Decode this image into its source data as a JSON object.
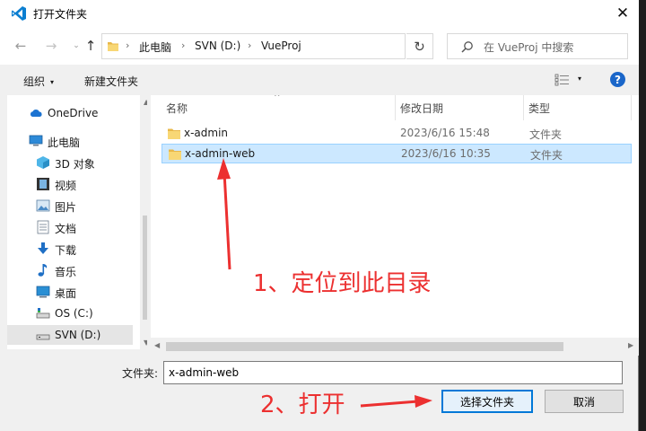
{
  "window": {
    "title": "打开文件夹",
    "close_glyph": "✕"
  },
  "nav": {
    "back_glyph": "←",
    "forward_glyph": "→",
    "recent_glyph": "⌄",
    "up_glyph": "↑",
    "refresh_glyph": "↻",
    "breadcrumb": [
      "此电脑",
      "SVN (D:)",
      "VueProj"
    ],
    "separator": "›",
    "dropdown_glyph": "⌄",
    "search_placeholder": "在 VueProj 中搜索"
  },
  "toolbar": {
    "organize_label": "组织",
    "organize_caret": "▾",
    "new_folder_label": "新建文件夹",
    "view_caret": "▾",
    "help_label": "?"
  },
  "sidebar": {
    "items": [
      {
        "label": "OneDrive",
        "icon": "onedrive-icon"
      },
      {
        "label": "此电脑",
        "icon": "computer-icon"
      },
      {
        "label": "3D 对象",
        "icon": "3d-objects-icon"
      },
      {
        "label": "视频",
        "icon": "video-icon"
      },
      {
        "label": "图片",
        "icon": "pictures-icon"
      },
      {
        "label": "文档",
        "icon": "documents-icon"
      },
      {
        "label": "下载",
        "icon": "downloads-icon"
      },
      {
        "label": "音乐",
        "icon": "music-icon"
      },
      {
        "label": "桌面",
        "icon": "desktop-icon"
      },
      {
        "label": "OS (C:)",
        "icon": "drive-c-icon"
      },
      {
        "label": "SVN (D:)",
        "icon": "drive-d-icon",
        "selected": true
      }
    ]
  },
  "file_list": {
    "columns": [
      "名称",
      "修改日期",
      "类型"
    ],
    "sort_glyph": "^",
    "rows": [
      {
        "name": "x-admin",
        "date": "2023/6/16 15:48",
        "type": "文件夹"
      },
      {
        "name": "x-admin-web",
        "date": "2023/6/16 10:35",
        "type": "文件夹",
        "selected": true
      }
    ]
  },
  "footer": {
    "folder_label": "文件夹:",
    "folder_value": "x-admin-web",
    "select_button": "选择文件夹",
    "cancel_button": "取消"
  },
  "annotations": {
    "step1": "1、定位到此目录",
    "step2": "2、打开"
  },
  "colors": {
    "accent": "#0078d7",
    "selection": "#cce8ff",
    "annotation": "#ec3030",
    "folder": "#f8d775"
  }
}
